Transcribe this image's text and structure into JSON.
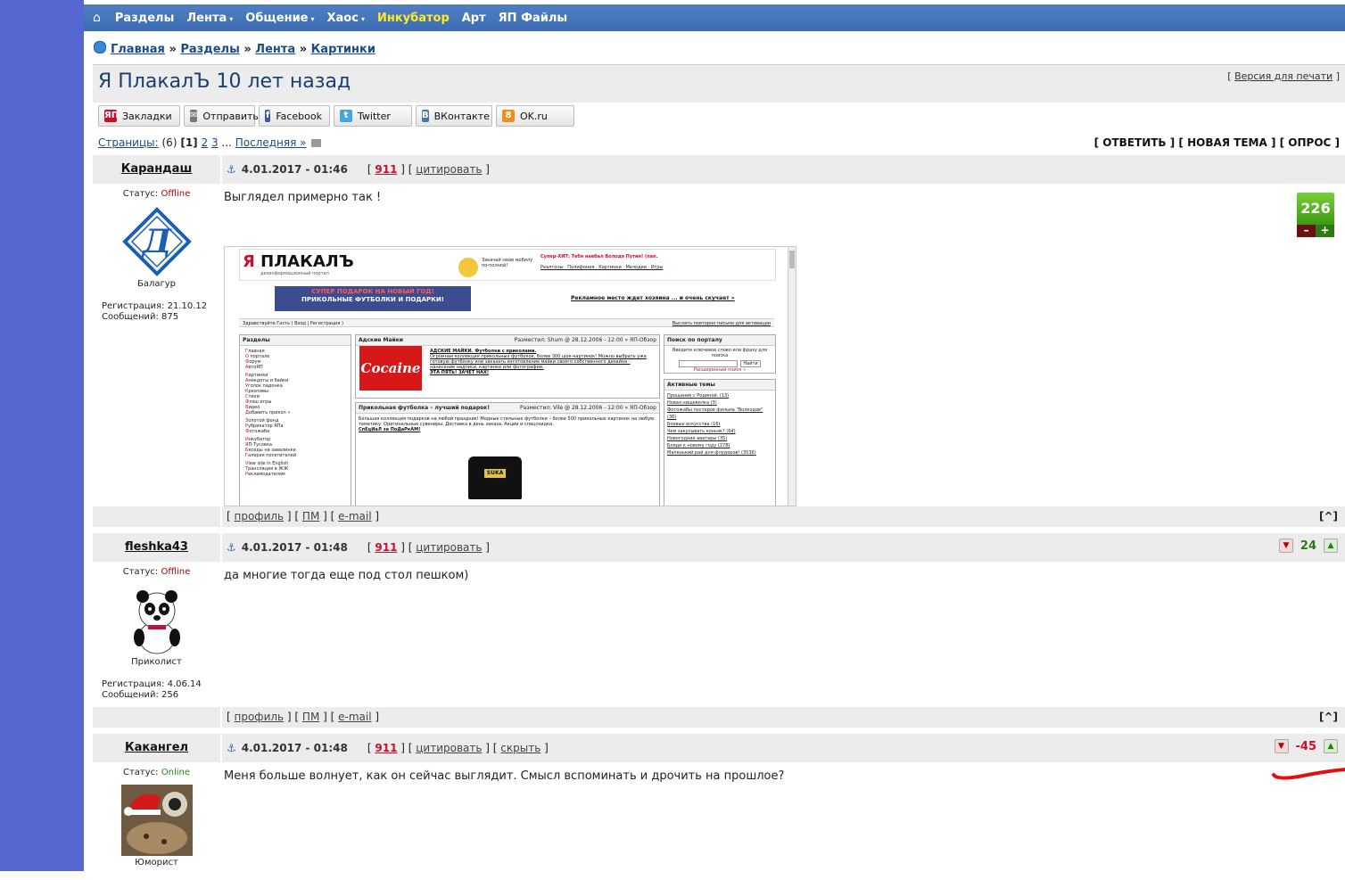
{
  "nav": {
    "home_icon": "home-icon",
    "items": [
      {
        "label": "Разделы",
        "dropdown": false,
        "highlight": false
      },
      {
        "label": "Лента",
        "dropdown": true,
        "highlight": false
      },
      {
        "label": "Общение",
        "dropdown": true,
        "highlight": false
      },
      {
        "label": "Хаос",
        "dropdown": true,
        "highlight": false
      },
      {
        "label": "Инкубатор",
        "dropdown": false,
        "highlight": true
      },
      {
        "label": "Арт",
        "dropdown": false,
        "highlight": false
      },
      {
        "label": "ЯП Файлы",
        "dropdown": false,
        "highlight": false
      }
    ],
    "caret": "▾"
  },
  "breadcrumbs": {
    "items": [
      "Главная",
      "Разделы",
      "Лента",
      "Картинки"
    ],
    "sep": "»"
  },
  "topic": {
    "title": "Я ПлакалЪ 10 лет назад",
    "print_version": "Версия для печати",
    "bracket_open": "[",
    "bracket_close": "]"
  },
  "share": [
    {
      "label": "Закладки",
      "icon": "yap-icon",
      "icon_text": "ЯП",
      "color": "#c8102e"
    },
    {
      "label": "Отправить",
      "icon": "mail-icon",
      "icon_text": "✉",
      "color": "#777777"
    },
    {
      "label": "Facebook",
      "icon": "facebook-icon",
      "icon_text": "f",
      "color": "#3b5998"
    },
    {
      "label": "Twitter",
      "icon": "twitter-icon",
      "icon_text": "t",
      "color": "#4aa3df"
    },
    {
      "label": "ВКонтакте",
      "icon": "vk-icon",
      "icon_text": "B",
      "color": "#4c75a3"
    },
    {
      "label": "OK.ru",
      "icon": "ok-icon",
      "icon_text": "8",
      "color": "#f28c1f"
    }
  ],
  "pagination": {
    "label": "Страницы:",
    "count": "(6)",
    "current": "[1]",
    "pages": [
      "2",
      "3"
    ],
    "ellipsis": "...",
    "last": "Последняя »"
  },
  "actions": "[ ОТВЕТИТЬ ] [ НОВАЯ ТЕМА ] [ ОПРОС ]",
  "footer_links": {
    "profile": "профиль",
    "pm": "ПМ",
    "email": "e-mail",
    "to_top": "[^]"
  },
  "posts": [
    {
      "username": "Карандаш",
      "datetime": "4.01.2017 - 01:46",
      "post_num": "911",
      "quote": "цитировать",
      "hide": "",
      "status_label": "Статус:",
      "status": "Offline",
      "rank": "Балагур",
      "reg": "Регистрация: 21.10.12",
      "messages": "Сообщений: 875",
      "text": "Выглядел примерно так !",
      "karma": "226",
      "karma_minus": "–",
      "karma_plus": "+"
    },
    {
      "username": "fleshka43",
      "datetime": "4.01.2017 - 01:48",
      "post_num": "911",
      "quote": "цитировать",
      "hide": "",
      "status_label": "Статус:",
      "status": "Offline",
      "rank": "Приколист",
      "reg": "Регистрация: 4.06.14",
      "messages": "Сообщений: 256",
      "text": "да многие тогда еще под стол пешком)",
      "karma": "24"
    },
    {
      "username": "Какангел",
      "datetime": "4.01.2017 - 01:48",
      "post_num": "911",
      "quote": "цитировать",
      "hide": "скрыть",
      "status_label": "Статус:",
      "status": "Online",
      "rank": "Юморист",
      "reg": "",
      "messages": "",
      "text": "Меня больше волнует, как он сейчас выглядит. Смысл вспоминать и дрочить на прошлое?",
      "karma": "-45"
    }
  ],
  "embedded_screenshot": {
    "logo": "ПЛАКАЛЪ",
    "logo_sub": "дезинформационный портал",
    "promo_line": "Закачай свою мобилу по-полной!",
    "promo_hit": "Супер-ХИТ: Тебя наебал Володя Путин! (пап.",
    "promo_links": "Реалтоны · Полифония · Картинки · Мелодии · Игры",
    "banner_top": "СУПЕР ПОДАРОК НА НОВЫЙ ГОД!",
    "banner_main": "ПРИКОЛЬНЫЕ ФУТБОЛКИ И ПОДАРКИ!",
    "ad_link": "Рекламное место ждет хозяина ... и очень скучает »",
    "greet": "Здравствуйте Гость ( Вход | Регистрация )",
    "greet_right": "Выслать повторно письмо для активации",
    "sections_title": "Разделы",
    "sections": [
      "Главная",
      "О портале",
      "Форум",
      "АвтоЯП",
      "Картинки",
      "Анекдоты и байки",
      "Уголок падонка",
      "Креативы",
      "Стихи",
      "Флэш игры",
      "Видео",
      "Добавить прикол »",
      "Золотой фонд",
      "Рубрикатор ЯПа",
      "Фотожаба",
      "Инкубатор",
      "ЯП-Тусовка",
      "Беседы на завалинке",
      "Галерея посетителей",
      "View site in English",
      "Трансляция в ЖЖ",
      "Рекламодателям"
    ],
    "post1_title": "Адские Майки",
    "post1_meta": "Разместил: Shum @ 28.12.2006 - 12:00 » ЯП-Обзор",
    "post1_head": "АДСКИЕ МАЙКИ. Футболки с приколами.",
    "post1_body": "Огромная коллекция прикольных футболок, более 300 шок-картинок! Можно выбрать уже готовую футболку или заказать изготовление майки своего собственного дизайна - нанесение надписи, картинки или фотографии.",
    "post1_link": "ЭТА ПЯТЬ! ЗАЧЁТ НАХ!",
    "cocaine_label": "Cocaine",
    "post2_title": "Прикольная футболка – лучший подарок!",
    "post2_meta": "Разместил: Vile @ 28.12.2006 - 12:00 » ЯП-Обзор",
    "post2_body": "Большая коллекция подарков на любой праздник! Модные стильные футболки – более 500 прикольных картинок на любую тематику. Оригинальные сувениры. Доставка в день заказа. Акции и спецскидки.",
    "post2_link": "СпЕцИаЛ за ПоДаРкАМ!",
    "tshirt_label": "SUKA",
    "search_title": "Поиск по порталу",
    "search_hint": "Введите ключевое слово или фразу для поиска",
    "search_btn": "Найти",
    "search_adv": "Расширенный поиск »",
    "active_title": "Активные темы",
    "active": [
      "Прощание с Родиной. (13)",
      "Новая нищеволка (3)",
      "Фотожабы постеров фильма \"Волкодав\" (36)",
      "Боевые искусства (16)",
      "Чем закусывать коньяк? (64)",
      "Новогодние аватары (35)",
      "Бляди к новому году (278)",
      "Маленький рай для флудеров! (3536)"
    ]
  }
}
